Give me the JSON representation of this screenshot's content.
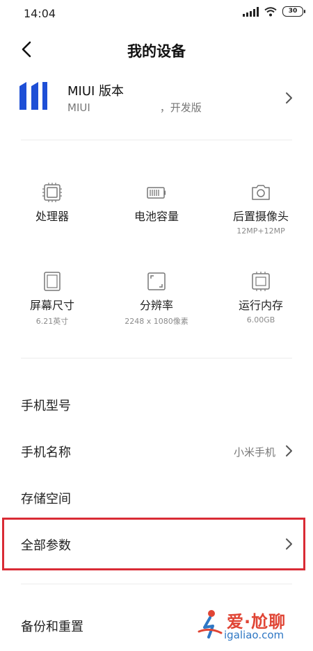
{
  "status_bar": {
    "time": "14:04",
    "battery": "30"
  },
  "header": {
    "title": "我的设备"
  },
  "miui": {
    "title": "MIUI 版本",
    "subtitle_prefix": "MIUI",
    "subtitle_suffix": "，开发版"
  },
  "specs": [
    {
      "label": "处理器",
      "value": "",
      "icon": "cpu-icon"
    },
    {
      "label": "电池容量",
      "value": "",
      "icon": "battery-icon"
    },
    {
      "label": "后置摄像头",
      "value": "12MP+12MP",
      "icon": "camera-icon"
    },
    {
      "label": "屏幕尺寸",
      "value": "6.21英寸",
      "icon": "screen-icon"
    },
    {
      "label": "分辨率",
      "value": "2248 x 1080像素",
      "icon": "resolution-icon"
    },
    {
      "label": "运行内存",
      "value": "6.00GB",
      "icon": "memory-icon"
    }
  ],
  "list": [
    {
      "label": "手机型号",
      "value": ""
    },
    {
      "label": "手机名称",
      "value": "小米手机"
    },
    {
      "label": "存储空间",
      "value": ""
    },
    {
      "label": "全部参数",
      "value": ""
    },
    {
      "label": "备份和重置",
      "value": ""
    }
  ],
  "watermark": {
    "top": "爱·尬聊",
    "bottom": "igaliao.com"
  },
  "colors": {
    "highlight": "#d92b35",
    "miui_logo": "#1e4fd6",
    "watermark_red": "#e04535",
    "watermark_blue": "#2e77c4"
  }
}
